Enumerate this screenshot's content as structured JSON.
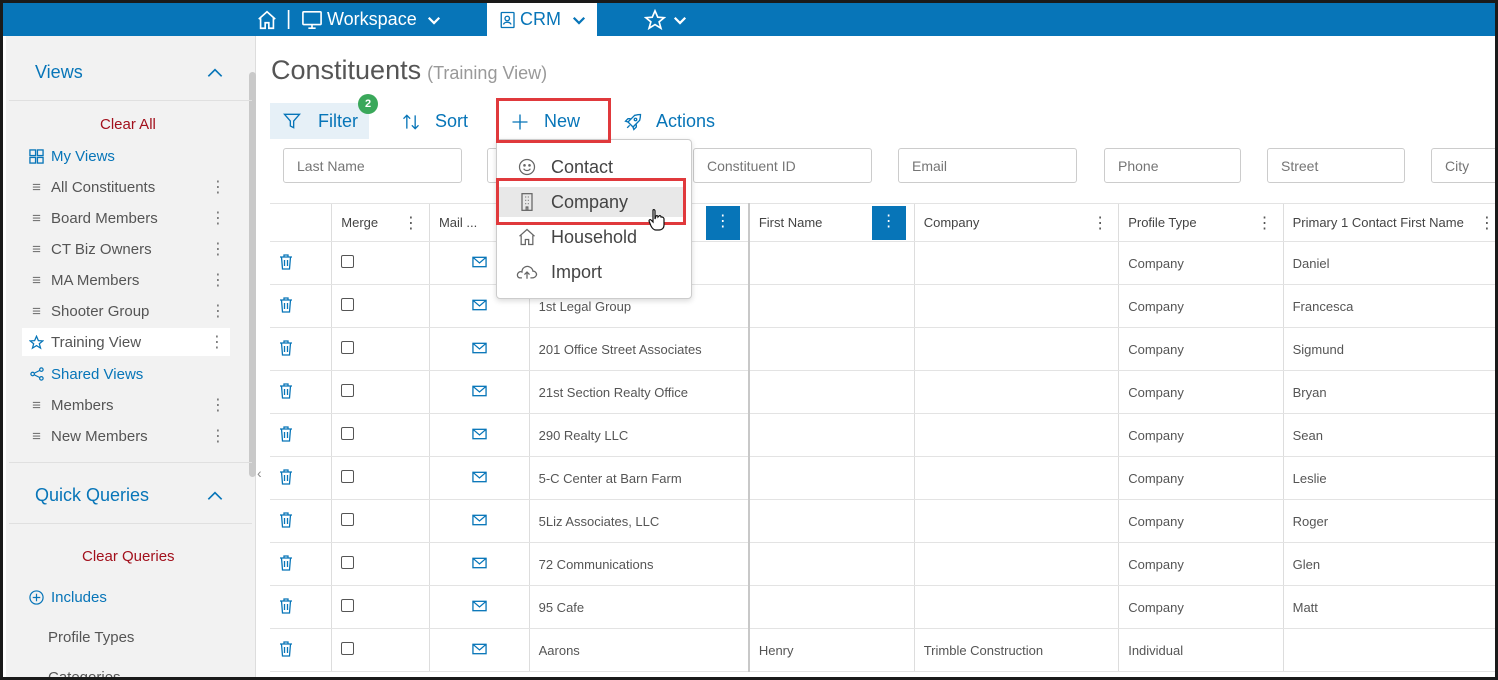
{
  "nav": {
    "workspace_label": "Workspace",
    "crm_label": "CRM"
  },
  "page": {
    "title": "Constituents",
    "subtitle": "(Training View)"
  },
  "toolbar": {
    "filter_label": "Filter",
    "filter_count": "2",
    "sort_label": "Sort",
    "new_label": "New",
    "actions_label": "Actions"
  },
  "new_menu": {
    "items": [
      "Contact",
      "Company",
      "Household",
      "Import"
    ]
  },
  "filters": {
    "placeholders": [
      "Last Name",
      "",
      "Constituent ID",
      "Email",
      "Phone",
      "Street",
      "City"
    ]
  },
  "sidebar": {
    "views_title": "Views",
    "clear_all": "Clear All",
    "my_views": "My Views",
    "items": [
      "All Constituents",
      "Board Members",
      "CT Biz Owners",
      "MA Members",
      "Shooter Group",
      "Training View"
    ],
    "shared_views": "Shared Views",
    "shared_items": [
      "Members",
      "New Members"
    ],
    "quick_queries_title": "Quick Queries",
    "clear_queries": "Clear Queries",
    "includes": "Includes",
    "profile_types": "Profile Types",
    "categories": "Categories"
  },
  "grid": {
    "headers": [
      "Merge",
      "Mail ...",
      "",
      "First Name",
      "Company",
      "Profile Type",
      "Primary 1 Contact First Name"
    ],
    "rows": [
      {
        "name": "",
        "first": "",
        "company": "",
        "type": "Company",
        "contact": "Daniel"
      },
      {
        "name": "1st Legal Group",
        "first": "",
        "company": "",
        "type": "Company",
        "contact": "Francesca"
      },
      {
        "name": "201 Office Street Associates",
        "first": "",
        "company": "",
        "type": "Company",
        "contact": "Sigmund"
      },
      {
        "name": "21st Section Realty Office",
        "first": "",
        "company": "",
        "type": "Company",
        "contact": "Bryan"
      },
      {
        "name": "290 Realty LLC",
        "first": "",
        "company": "",
        "type": "Company",
        "contact": "Sean"
      },
      {
        "name": "5-C Center at Barn Farm",
        "first": "",
        "company": "",
        "type": "Company",
        "contact": "Leslie"
      },
      {
        "name": "5Liz Associates, LLC",
        "first": "",
        "company": "",
        "type": "Company",
        "contact": "Roger"
      },
      {
        "name": "72 Communications",
        "first": "",
        "company": "",
        "type": "Company",
        "contact": "Glen"
      },
      {
        "name": "95 Cafe",
        "first": "",
        "company": "",
        "type": "Company",
        "contact": "Matt"
      },
      {
        "name": "Aarons",
        "first": "Henry",
        "company": "Trimble Construction",
        "type": "Individual",
        "contact": ""
      }
    ]
  },
  "colors": {
    "brand": "#0775b8",
    "highlight": "#e0393c",
    "badge": "#3aa85a"
  }
}
